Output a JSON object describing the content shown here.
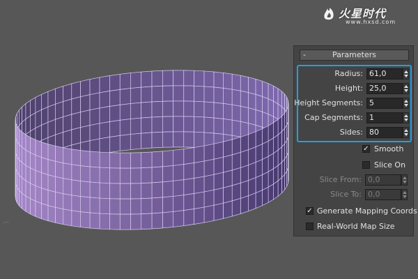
{
  "watermark": {
    "brand": "火星时代",
    "url": "www.hxsd.com"
  },
  "viewport": {
    "object": "tube",
    "colors": {
      "background": "#575757",
      "mesh_outer": "#9a82c8",
      "mesh_inner": "#6d5a96",
      "wire": "#d6ccee"
    }
  },
  "panel": {
    "rollout_toggle": "-",
    "rollout_title": "Parameters",
    "highlight_color": "#1fa0e6",
    "params": [
      {
        "label": "Radius:",
        "value": "61,0"
      },
      {
        "label": "Height:",
        "value": "25,0"
      },
      {
        "label": "Height Segments:",
        "value": "5"
      },
      {
        "label": "Cap Segments:",
        "value": "1"
      },
      {
        "label": "Sides:",
        "value": "80"
      }
    ],
    "smooth": {
      "label": "Smooth",
      "checked": "✓"
    },
    "slice_on": {
      "label": "Slice On",
      "checked": ""
    },
    "slice_from": {
      "label": "Slice From:",
      "value": "0,0"
    },
    "slice_to": {
      "label": "Slice To:",
      "value": "0,0"
    },
    "gen_mapping": {
      "label": "Generate Mapping Coords.",
      "checked": "✓"
    },
    "real_world": {
      "label": "Real-World Map Size",
      "checked": ""
    }
  }
}
